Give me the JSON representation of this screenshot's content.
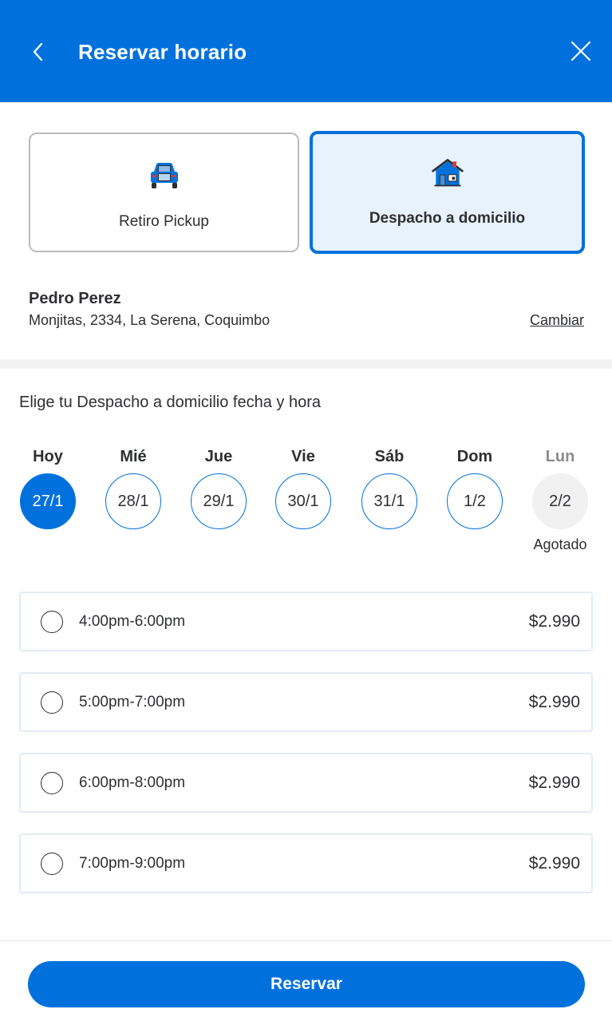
{
  "header": {
    "title": "Reservar horario"
  },
  "methods": {
    "pickup": {
      "label": "Retiro Pickup"
    },
    "delivery": {
      "label": "Despacho a domicilio",
      "selected": true
    }
  },
  "address": {
    "name": "Pedro Perez",
    "line": "Monjitas, 2334, La Serena, Coquimbo",
    "change_label": "Cambiar"
  },
  "schedule": {
    "title": "Elige tu Despacho a domicilio fecha y hora",
    "days": [
      {
        "name": "Hoy",
        "date": "27/1",
        "state": "selected"
      },
      {
        "name": "Mié",
        "date": "28/1",
        "state": "available"
      },
      {
        "name": "Jue",
        "date": "29/1",
        "state": "available"
      },
      {
        "name": "Vie",
        "date": "30/1",
        "state": "available"
      },
      {
        "name": "Sáb",
        "date": "31/1",
        "state": "available"
      },
      {
        "name": "Dom",
        "date": "1/2",
        "state": "available"
      },
      {
        "name": "Lun",
        "date": "2/2",
        "state": "disabled",
        "note": "Agotado"
      }
    ],
    "slots": [
      {
        "time": "4:00pm-6:00pm",
        "price": "$2.990"
      },
      {
        "time": "5:00pm-7:00pm",
        "price": "$2.990"
      },
      {
        "time": "6:00pm-8:00pm",
        "price": "$2.990"
      },
      {
        "time": "7:00pm-9:00pm",
        "price": "$2.990"
      }
    ]
  },
  "footer": {
    "reserve_label": "Reservar"
  },
  "colors": {
    "brand": "#0071dc",
    "selected_card_bg": "#e8f2fc",
    "disabled_day_bg": "#f1f1f2"
  },
  "icons": {
    "back": "chevron-left-icon",
    "close": "close-icon",
    "pickup": "car-icon",
    "delivery": "house-icon"
  }
}
